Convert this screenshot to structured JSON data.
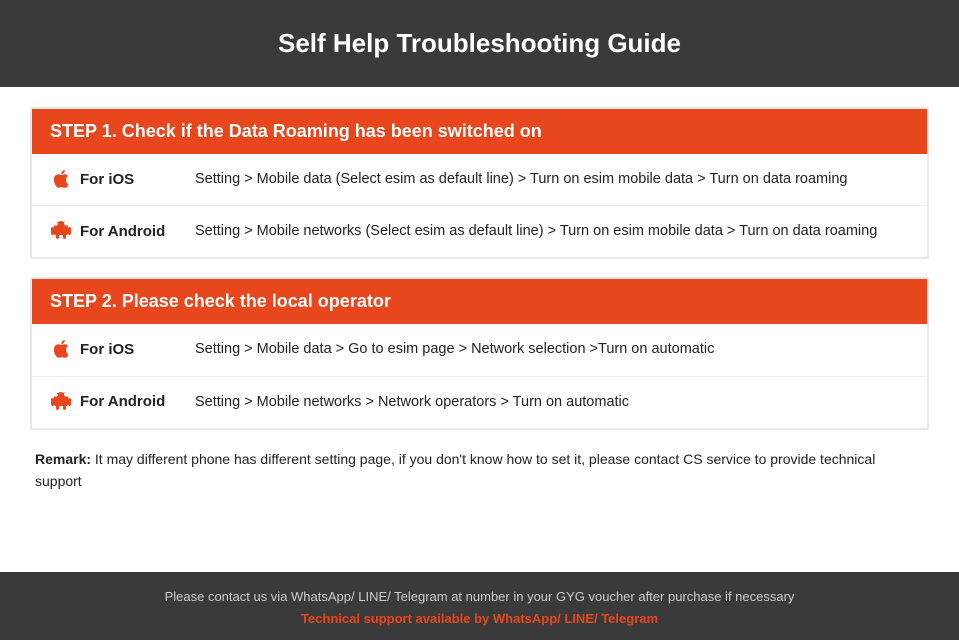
{
  "header": {
    "title": "Self Help Troubleshooting Guide"
  },
  "step1": {
    "header": "STEP 1.  Check if the Data Roaming has been switched on",
    "rows": [
      {
        "platform": "For iOS",
        "icon": "apple",
        "text": "Setting > Mobile data (Select esim as default line) > Turn on esim mobile data > Turn on data roaming"
      },
      {
        "platform": "For Android",
        "icon": "android",
        "text": "Setting > Mobile networks (Select esim as default line) > Turn on esim mobile data > Turn on data roaming"
      }
    ]
  },
  "step2": {
    "header": "STEP 2.  Please check the local operator",
    "rows": [
      {
        "platform": "For iOS",
        "icon": "apple",
        "text": "Setting > Mobile data > Go to esim page > Network selection >Turn on automatic"
      },
      {
        "platform": "For Android",
        "icon": "android",
        "text": "Setting > Mobile networks > Network operators > Turn on automatic"
      }
    ]
  },
  "remark": {
    "label": "Remark:",
    "text": "It may different phone has different setting page, if you don't know how to set it,  please contact CS service to provide technical support"
  },
  "footer": {
    "line1": "Please contact us via WhatsApp/ LINE/ Telegram at number in your GYG voucher after purchase if necessary",
    "line2": "Technical support available by WhatsApp/ LINE/ Telegram"
  }
}
